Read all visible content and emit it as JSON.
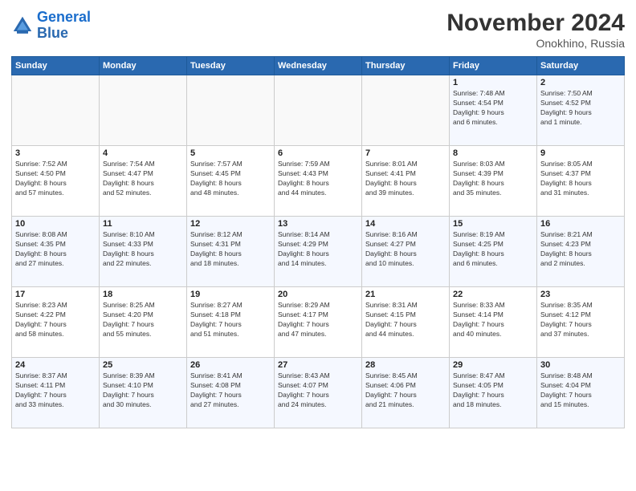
{
  "logo": {
    "line1": "General",
    "line2": "Blue"
  },
  "title": "November 2024",
  "location": "Onokhino, Russia",
  "weekdays": [
    "Sunday",
    "Monday",
    "Tuesday",
    "Wednesday",
    "Thursday",
    "Friday",
    "Saturday"
  ],
  "weeks": [
    [
      {
        "day": "",
        "detail": ""
      },
      {
        "day": "",
        "detail": ""
      },
      {
        "day": "",
        "detail": ""
      },
      {
        "day": "",
        "detail": ""
      },
      {
        "day": "",
        "detail": ""
      },
      {
        "day": "1",
        "detail": "Sunrise: 7:48 AM\nSunset: 4:54 PM\nDaylight: 9 hours\nand 6 minutes."
      },
      {
        "day": "2",
        "detail": "Sunrise: 7:50 AM\nSunset: 4:52 PM\nDaylight: 9 hours\nand 1 minute."
      }
    ],
    [
      {
        "day": "3",
        "detail": "Sunrise: 7:52 AM\nSunset: 4:50 PM\nDaylight: 8 hours\nand 57 minutes."
      },
      {
        "day": "4",
        "detail": "Sunrise: 7:54 AM\nSunset: 4:47 PM\nDaylight: 8 hours\nand 52 minutes."
      },
      {
        "day": "5",
        "detail": "Sunrise: 7:57 AM\nSunset: 4:45 PM\nDaylight: 8 hours\nand 48 minutes."
      },
      {
        "day": "6",
        "detail": "Sunrise: 7:59 AM\nSunset: 4:43 PM\nDaylight: 8 hours\nand 44 minutes."
      },
      {
        "day": "7",
        "detail": "Sunrise: 8:01 AM\nSunset: 4:41 PM\nDaylight: 8 hours\nand 39 minutes."
      },
      {
        "day": "8",
        "detail": "Sunrise: 8:03 AM\nSunset: 4:39 PM\nDaylight: 8 hours\nand 35 minutes."
      },
      {
        "day": "9",
        "detail": "Sunrise: 8:05 AM\nSunset: 4:37 PM\nDaylight: 8 hours\nand 31 minutes."
      }
    ],
    [
      {
        "day": "10",
        "detail": "Sunrise: 8:08 AM\nSunset: 4:35 PM\nDaylight: 8 hours\nand 27 minutes."
      },
      {
        "day": "11",
        "detail": "Sunrise: 8:10 AM\nSunset: 4:33 PM\nDaylight: 8 hours\nand 22 minutes."
      },
      {
        "day": "12",
        "detail": "Sunrise: 8:12 AM\nSunset: 4:31 PM\nDaylight: 8 hours\nand 18 minutes."
      },
      {
        "day": "13",
        "detail": "Sunrise: 8:14 AM\nSunset: 4:29 PM\nDaylight: 8 hours\nand 14 minutes."
      },
      {
        "day": "14",
        "detail": "Sunrise: 8:16 AM\nSunset: 4:27 PM\nDaylight: 8 hours\nand 10 minutes."
      },
      {
        "day": "15",
        "detail": "Sunrise: 8:19 AM\nSunset: 4:25 PM\nDaylight: 8 hours\nand 6 minutes."
      },
      {
        "day": "16",
        "detail": "Sunrise: 8:21 AM\nSunset: 4:23 PM\nDaylight: 8 hours\nand 2 minutes."
      }
    ],
    [
      {
        "day": "17",
        "detail": "Sunrise: 8:23 AM\nSunset: 4:22 PM\nDaylight: 7 hours\nand 58 minutes."
      },
      {
        "day": "18",
        "detail": "Sunrise: 8:25 AM\nSunset: 4:20 PM\nDaylight: 7 hours\nand 55 minutes."
      },
      {
        "day": "19",
        "detail": "Sunrise: 8:27 AM\nSunset: 4:18 PM\nDaylight: 7 hours\nand 51 minutes."
      },
      {
        "day": "20",
        "detail": "Sunrise: 8:29 AM\nSunset: 4:17 PM\nDaylight: 7 hours\nand 47 minutes."
      },
      {
        "day": "21",
        "detail": "Sunrise: 8:31 AM\nSunset: 4:15 PM\nDaylight: 7 hours\nand 44 minutes."
      },
      {
        "day": "22",
        "detail": "Sunrise: 8:33 AM\nSunset: 4:14 PM\nDaylight: 7 hours\nand 40 minutes."
      },
      {
        "day": "23",
        "detail": "Sunrise: 8:35 AM\nSunset: 4:12 PM\nDaylight: 7 hours\nand 37 minutes."
      }
    ],
    [
      {
        "day": "24",
        "detail": "Sunrise: 8:37 AM\nSunset: 4:11 PM\nDaylight: 7 hours\nand 33 minutes."
      },
      {
        "day": "25",
        "detail": "Sunrise: 8:39 AM\nSunset: 4:10 PM\nDaylight: 7 hours\nand 30 minutes."
      },
      {
        "day": "26",
        "detail": "Sunrise: 8:41 AM\nSunset: 4:08 PM\nDaylight: 7 hours\nand 27 minutes."
      },
      {
        "day": "27",
        "detail": "Sunrise: 8:43 AM\nSunset: 4:07 PM\nDaylight: 7 hours\nand 24 minutes."
      },
      {
        "day": "28",
        "detail": "Sunrise: 8:45 AM\nSunset: 4:06 PM\nDaylight: 7 hours\nand 21 minutes."
      },
      {
        "day": "29",
        "detail": "Sunrise: 8:47 AM\nSunset: 4:05 PM\nDaylight: 7 hours\nand 18 minutes."
      },
      {
        "day": "30",
        "detail": "Sunrise: 8:48 AM\nSunset: 4:04 PM\nDaylight: 7 hours\nand 15 minutes."
      }
    ]
  ]
}
